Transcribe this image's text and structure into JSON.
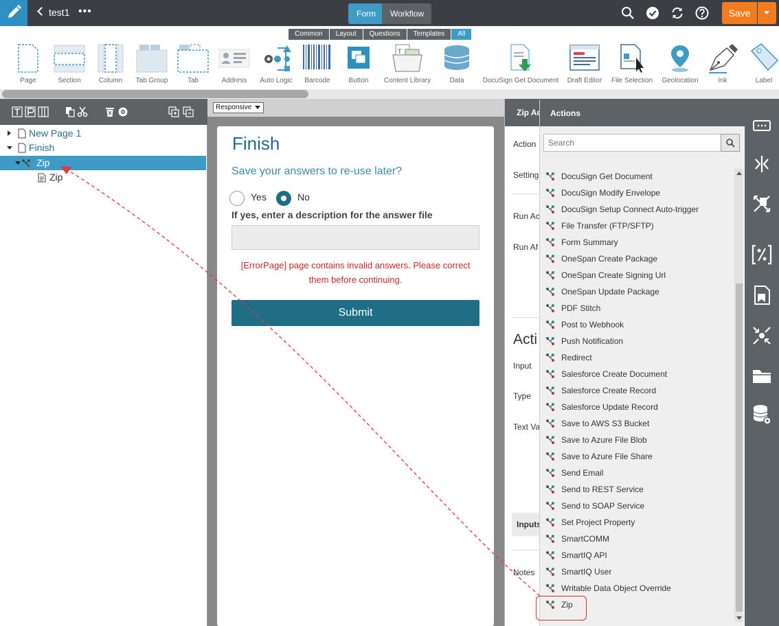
{
  "topbar": {
    "project_title": "test1",
    "more": "•••",
    "form_tab": "Form",
    "workflow_tab": "Workflow",
    "save_label": "Save"
  },
  "toolbox": {
    "tabs": [
      "Common",
      "Layout",
      "Questions",
      "Templates",
      "All"
    ],
    "tools": [
      "Page",
      "Section",
      "Column",
      "Tab Group",
      "Tab",
      "Address",
      "Auto Logic",
      "Barcode",
      "Button",
      "Content Library",
      "Data",
      "DocuSign Get Document",
      "Draft Editor",
      "File Selection",
      "Geolocation",
      "Ink",
      "Label"
    ]
  },
  "tree": {
    "items": [
      "New Page 1",
      "Finish",
      "Zip",
      "Zip"
    ]
  },
  "center": {
    "mode_select": "Responsive",
    "form_title": "Finish",
    "question": "Save your answers to re-use later?",
    "option_yes": "Yes",
    "option_no": "No",
    "description_label": "If yes, enter a description for the answer file",
    "error_text": "[ErrorPage] page contains invalid answers. Please correct them before continuing.",
    "submit_label": "Submit"
  },
  "right_panel": {
    "header": "Zip Ac",
    "labels": [
      "Action",
      "Setting",
      "Run Ac",
      "Run Af",
      "Acti",
      "Input",
      "Type",
      "Text Va",
      "Inputs",
      "Notes"
    ]
  },
  "actions_dropdown": {
    "header": "Actions",
    "search_placeholder": "Search",
    "items": [
      "DocuSign Get Document",
      "DocuSign Modify Envelope",
      "DocuSign Setup Connect Auto-trigger",
      "File Transfer (FTP/SFTP)",
      "Form Summary",
      "OneSpan Create Package",
      "OneSpan Create Signing Url",
      "OneSpan Update Package",
      "PDF Stitch",
      "Post to Webhook",
      "Push Notification",
      "Redirect",
      "Salesforce Create Document",
      "Salesforce Create Record",
      "Salesforce Update Record",
      "Save to AWS S3 Bucket",
      "Save to Azure File Blob",
      "Save to Azure File Share",
      "Send Email",
      "Send to REST Service",
      "Send to SOAP Service",
      "Set Project Property",
      "SmartCOMM",
      "SmartIQ API",
      "SmartIQ User",
      "Writable Data Object Override",
      "Zip"
    ]
  },
  "colors": {
    "topbar": "#3b3f44",
    "accent": "#3d9bc6",
    "form_primary": "#1f6e86",
    "save": "#f47c20",
    "error": "#c62828",
    "annotation": "#e53935"
  }
}
